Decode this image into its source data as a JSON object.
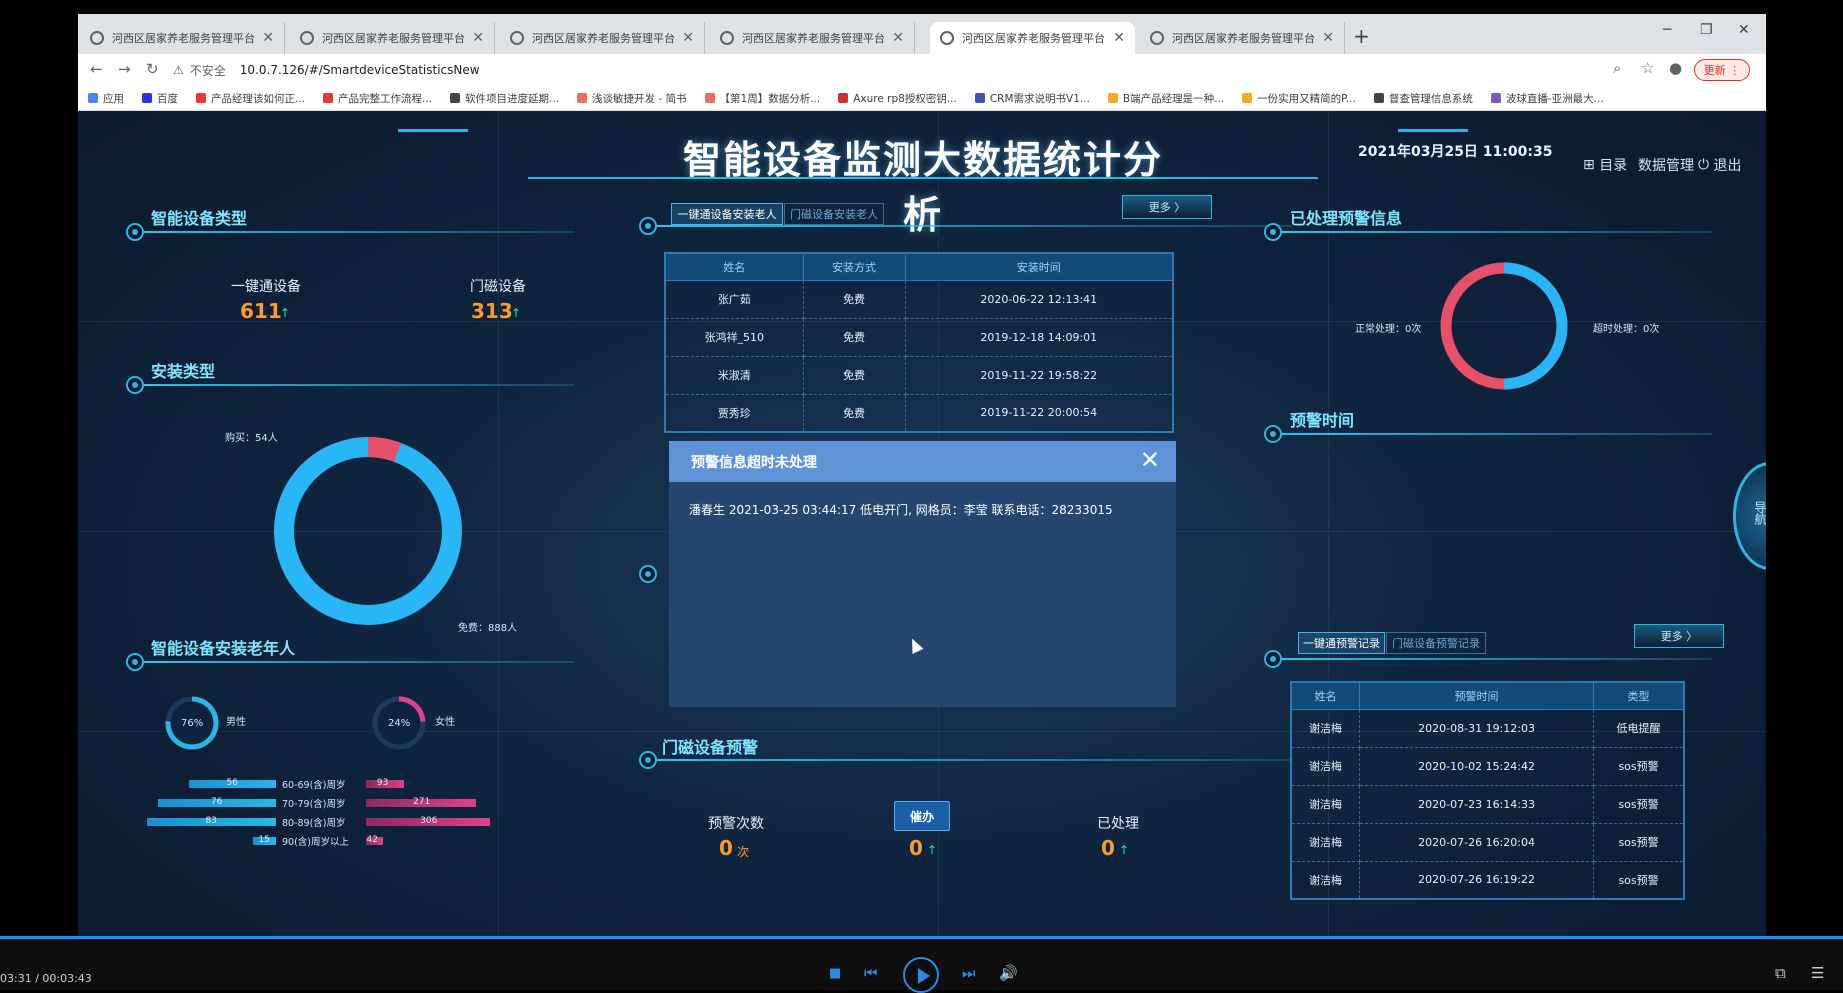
{
  "browser": {
    "tabs": [
      {
        "title": "河西区居家养老服务管理平台",
        "active": false
      },
      {
        "title": "河西区居家养老服务管理平台",
        "active": false
      },
      {
        "title": "河西区居家养老服务管理平台",
        "active": false
      },
      {
        "title": "河西区居家养老服务管理平台",
        "active": false
      },
      {
        "title": "河西区居家养老服务管理平台",
        "active": true
      },
      {
        "title": "河西区居家养老服务管理平台",
        "active": false
      }
    ],
    "new_tab": "+",
    "insecure_label": "不安全",
    "url": "10.0.7.126/#/SmartdeviceStatisticsNew",
    "update_label": "更新",
    "bookmarks": [
      {
        "label": "应用",
        "color": "#4285f4"
      },
      {
        "label": "百度",
        "color": "#2932e1"
      },
      {
        "label": "产品经理该如何正...",
        "color": "#e53935"
      },
      {
        "label": "产品完整工作流程...",
        "color": "#e53935"
      },
      {
        "label": "软件项目进度延期...",
        "color": "#444444"
      },
      {
        "label": "浅谈敏捷开发 - 简书",
        "color": "#ea6f5a"
      },
      {
        "label": "【第1周】数据分析...",
        "color": "#ea6f5a"
      },
      {
        "label": "Axure rp8授权密钥...",
        "color": "#d32f2f"
      },
      {
        "label": "CRM需求说明书V1...",
        "color": "#3f51b5"
      },
      {
        "label": "B端产品经理是一种...",
        "color": "#f9a825"
      },
      {
        "label": "一份实用又精简的P...",
        "color": "#f9a825"
      },
      {
        "label": "督查管理信息系统",
        "color": "#444444"
      },
      {
        "label": "波球直播-亚洲最大...",
        "color": "#7e57c2"
      }
    ]
  },
  "dashboard": {
    "title": "智能设备监测大数据统计分析",
    "datetime": "2021年03月25日 11:00:35",
    "nav": {
      "catalog": "目录",
      "data_mgmt": "数据管理",
      "logout": "退出"
    },
    "device_type": {
      "title": "智能设备类型",
      "items": [
        {
          "label": "一键通设备",
          "value": "611"
        },
        {
          "label": "门磁设备",
          "value": "313"
        }
      ]
    },
    "install_type": {
      "title": "安装类型",
      "purchase_label": "购买：54人",
      "free_label": "免费：888人"
    },
    "elderly": {
      "title": "智能设备安装老年人",
      "male_pct": "76%",
      "male_label": "男性",
      "female_pct": "24%",
      "female_label": "女性",
      "ages": [
        {
          "label": "60-69(含)周岁",
          "male": "56",
          "female": "93"
        },
        {
          "label": "70-79(含)周岁",
          "male": "76",
          "female": "271"
        },
        {
          "label": "80-89(含)周岁",
          "male": "83",
          "female": "306"
        },
        {
          "label": "90(含)周岁以上",
          "male": "15",
          "female": "42"
        }
      ]
    },
    "install_people": {
      "tabs": [
        "一键通设备安装老人",
        "门磁设备安装老人"
      ],
      "more": "更多 〉",
      "headers": [
        "姓名",
        "安装方式",
        "安装时间"
      ],
      "rows": [
        [
          "张广茹",
          "免费",
          "2020-06-22 12:13:41"
        ],
        [
          "张鸿祥_510",
          "免费",
          "2019-12-18 14:09:01"
        ],
        [
          "米淑清",
          "免费",
          "2019-11-22 19:58:22"
        ],
        [
          "贾秀珍",
          "免费",
          "2019-11-22 20:00:54"
        ]
      ]
    },
    "door_warning": {
      "title": "门磁设备预警",
      "count_label": "预警次数",
      "count_value": "0",
      "count_unit": "次",
      "urge_button": "催办",
      "urge_value": "0",
      "processed_label": "已处理",
      "processed_value": "0"
    },
    "processed_warnings": {
      "title": "已处理预警信息",
      "normal_label": "正常处理：0次",
      "timeout_label": "超时处理：0次"
    },
    "warning_time": {
      "title": "预警时间"
    },
    "warning_records": {
      "tabs": [
        "一键通预警记录",
        "门磁设备预警记录"
      ],
      "more": "更多 〉",
      "headers": [
        "姓名",
        "预警时间",
        "类型"
      ],
      "rows": [
        [
          "谢洁梅",
          "2020-08-31 19:12:03",
          "低电提醒"
        ],
        [
          "谢洁梅",
          "2020-10-02 15:24:42",
          "sos预警"
        ],
        [
          "谢洁梅",
          "2020-07-23 16:14:33",
          "sos预警"
        ],
        [
          "谢洁梅",
          "2020-07-26 16:20:04",
          "sos预警"
        ],
        [
          "谢洁梅",
          "2020-07-26 16:19:22",
          "sos预警"
        ]
      ]
    },
    "side_nav": {
      "label": "导航"
    },
    "modal": {
      "title": "预警信息超时未处理",
      "message": "潘春生 2021-03-25 03:44:17 低电开门, 网格员：李莹 联系电话：28233015"
    }
  },
  "player": {
    "time": "03:31 / 00:03:43"
  },
  "colors": {
    "accent": "#2ab7e6",
    "orange_value": "#ff9a2e",
    "female_pink": "#e0428c",
    "male_blue": "#2ab7e6"
  }
}
